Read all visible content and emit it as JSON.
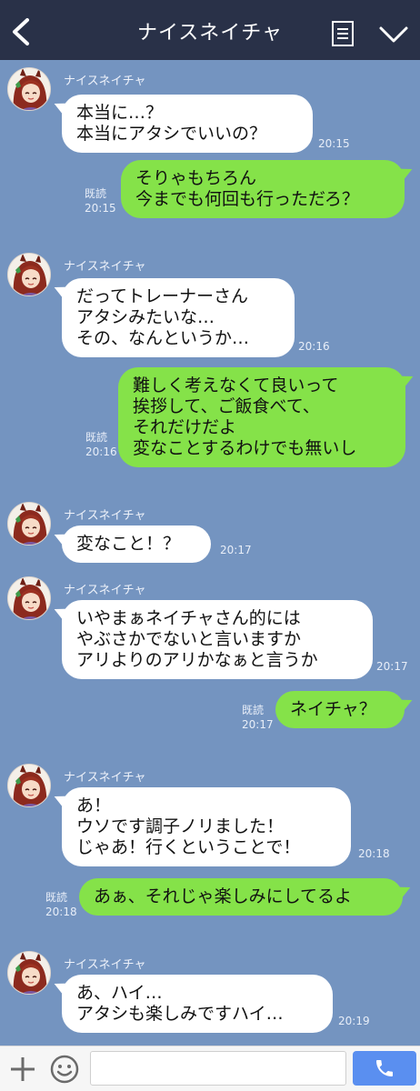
{
  "header": {
    "title": "ナイスネイチャ"
  },
  "contact": {
    "name": "ナイスネイチャ"
  },
  "read_label": "既読",
  "messages": [
    {
      "side": "in",
      "text": "本当に…？\n本当にアタシでいいの？",
      "time": "20:15"
    },
    {
      "side": "out",
      "text": "そりゃもちろん\n今までも何回も行っただろ？",
      "time": "20:15",
      "read": "既読"
    },
    {
      "side": "in",
      "text": "だってトレーナーさん\nアタシみたいな…\nその、なんというか…",
      "time": "20:16"
    },
    {
      "side": "out",
      "text": "難しく考えなくて良いって\n挨拶して、ご飯食べて、\nそれだけだよ\n変なことするわけでも無いし",
      "time": "20:16",
      "read": "既読"
    },
    {
      "side": "in",
      "text": "変なこと！？",
      "time": "20:17"
    },
    {
      "side": "in",
      "text": "いやまぁネイチャさん的には\nやぶさかでないと言いますか\nアリよりのアリかなぁと言うか",
      "time": "20:17"
    },
    {
      "side": "out",
      "text": "ネイチャ？",
      "time": "20:17",
      "read": "既読"
    },
    {
      "side": "in",
      "text": "あ！\nウソです調子ノリました！\nじゃあ！行くということで！",
      "time": "20:18"
    },
    {
      "side": "out",
      "text": "あぁ、それじゃ楽しみにしてるよ",
      "time": "20:18",
      "read": "既読"
    },
    {
      "side": "in",
      "text": "あ、ハイ…\nアタシも楽しみですハイ…",
      "time": "20:19"
    }
  ],
  "colors": {
    "background": "#7494c0",
    "header": "#293148",
    "incoming_bubble": "#ffffff",
    "outgoing_bubble": "#85e249",
    "send_button": "#5a8ff0"
  },
  "icons": {
    "back": "back-chevron-icon",
    "menu": "note-menu-icon",
    "dropdown": "chevron-down-icon",
    "add": "plus-icon",
    "emoji": "emoji-icon",
    "send": "phone-icon"
  },
  "composer": {
    "value": "",
    "placeholder": ""
  }
}
